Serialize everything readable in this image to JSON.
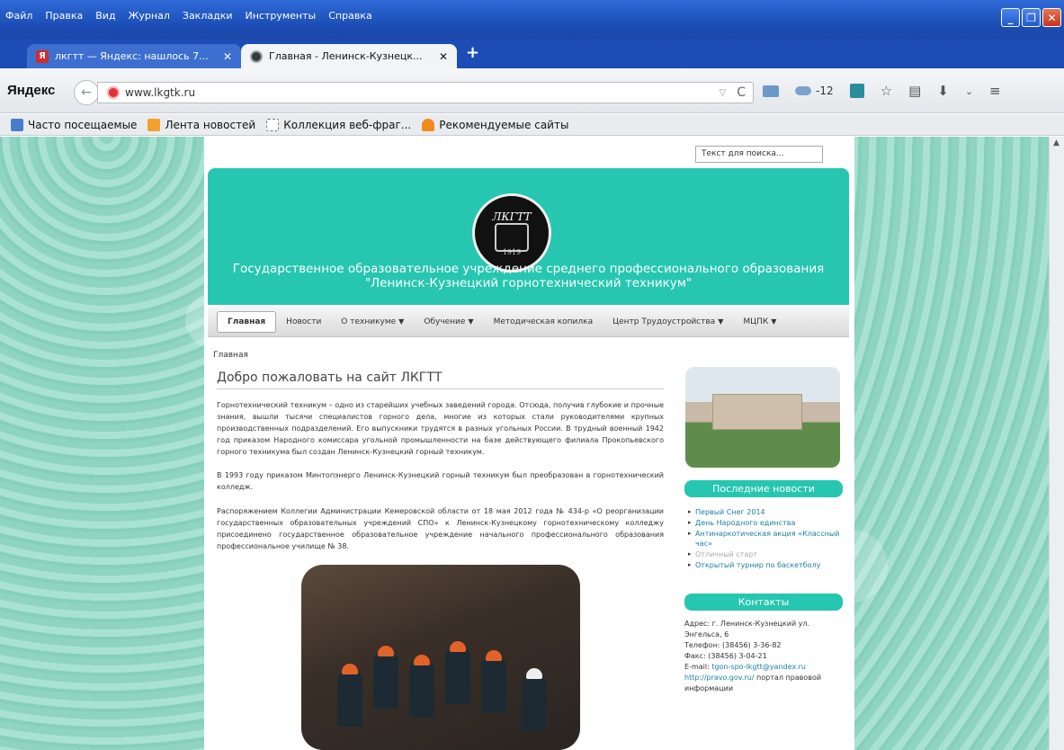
{
  "menu": [
    "Файл",
    "Правка",
    "Вид",
    "Журнал",
    "Закладки",
    "Инструменты",
    "Справка"
  ],
  "tabs": [
    {
      "title": "лкгтт — Яндекс: нашлось 7...",
      "favicon": "yandex-favicon"
    },
    {
      "title": "Главная - Ленинск-Кузнецк...",
      "favicon": "site-favicon"
    }
  ],
  "browser": {
    "logo": "Яндекс",
    "url": "www.lkgtk.ru",
    "weather": "-12"
  },
  "bookmarks": [
    "Часто посещаемые",
    "Лента новостей",
    "Коллекция веб-фраг...",
    "Рекомендуемые сайты"
  ],
  "site": {
    "search_placeholder": "Текст для поиска...",
    "logo_text": "ЛКГТТ",
    "logo_sub": "1919",
    "title_line1": "Государственное образовательное учреждение среднего профессионального образования",
    "title_line2": "\"Ленинск-Кузнецкий горнотехнический техникум\"",
    "nav": [
      {
        "label": "Главная",
        "dropdown": false
      },
      {
        "label": "Новости",
        "dropdown": false
      },
      {
        "label": "О техникуме",
        "dropdown": true
      },
      {
        "label": "Обучение",
        "dropdown": true
      },
      {
        "label": "Методическая копилка",
        "dropdown": false
      },
      {
        "label": "Центр Трудоустройства",
        "dropdown": true
      },
      {
        "label": "МЦПК",
        "dropdown": true
      }
    ],
    "breadcrumb": "Главная",
    "heading": "Добро пожаловать на сайт ЛКГТТ",
    "p1": "Горнотехнический техникум – одно из старейших учебных заведений города. Отсюда, получив глубокие и прочные знания, вышли тысячи специалистов горного дела, многие из которых стали руководителями крупных производственных подразделений. Его выпускники трудятся в разных угольных России. В трудный военный 1942 год приказом Народного комиссара угольной промышленности на базе действующего филиала Прокопьевского горного техникума был создан Ленинск-Кузнецкий горный техникум.",
    "p2": "В 1993 году приказом Минтопэнерго Ленинск-Кузнецкий горный техникум был преобразован в горнотехнический колледж.",
    "p3": "Распоряжением Коллегии Администрации Кемеровской области от 18 мая 2012 года № 434-р «О реорганизации государственных образовательных учреждений СПО» к Ленинск-Кузнецкому горнотехническому колледжу присоединено государственное образовательное учреждение начального профессионального образования профессиональное училище № 38.",
    "news_title": "Последние новости",
    "news": [
      {
        "text": "Первый Снег 2014",
        "grey": false
      },
      {
        "text": "День Народного единства",
        "grey": false
      },
      {
        "text": "Антинаркотическая акция «Классный час»",
        "grey": false
      },
      {
        "text": "Отличный старт",
        "grey": true
      },
      {
        "text": "Открытый турнир по баскетболу",
        "grey": false
      }
    ],
    "contacts_title": "Контакты",
    "contacts": {
      "address": "Адрес: г. Ленинск-Кузнецкий ул. Энгельса, 6",
      "phone": "Телефон: (38456) 3-36-82",
      "fax": "Факс: (38456) 3-04-21",
      "email_label": "E-mail:",
      "email": "tgon-spo-lkgtt@yandex.ru",
      "portal_link": "http://pravo.gov.ru/",
      "portal_text": "портал правовой информации"
    }
  }
}
